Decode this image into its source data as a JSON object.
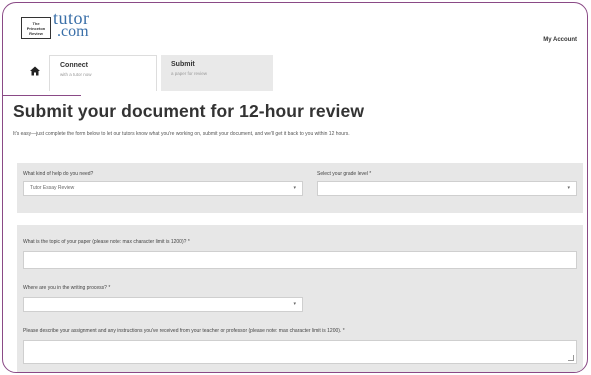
{
  "brand": {
    "box_line1": "The",
    "box_line2": "Princeton",
    "box_line3": "Review",
    "name_top": "tutor",
    "name_bottom": ".com"
  },
  "header": {
    "account_link": "My Account"
  },
  "steps": [
    {
      "title": "Connect",
      "subtitle": "with a tutor now"
    },
    {
      "title": "Submit",
      "subtitle": "a paper for review"
    }
  ],
  "page": {
    "title": "Submit your document for 12-hour review",
    "intro": "It's easy—just complete the form below to let our tutors know what you're working on, submit your document, and we'll get it back to you within 12 hours."
  },
  "form": {
    "help_label": "What kind of help do you need?",
    "help_value": "Tutor Essay Review",
    "grade_label": "Select your grade level",
    "topic_label": "What is the topic of your paper (please note: max character limit is 1200)?",
    "process_label": "Where are you in the writing process?",
    "assignment_label": "Please describe your assignment and any instructions you've received from your teacher or professor (please note: max character limit is 1200).",
    "required_mark": "*",
    "caret": "▾"
  }
}
